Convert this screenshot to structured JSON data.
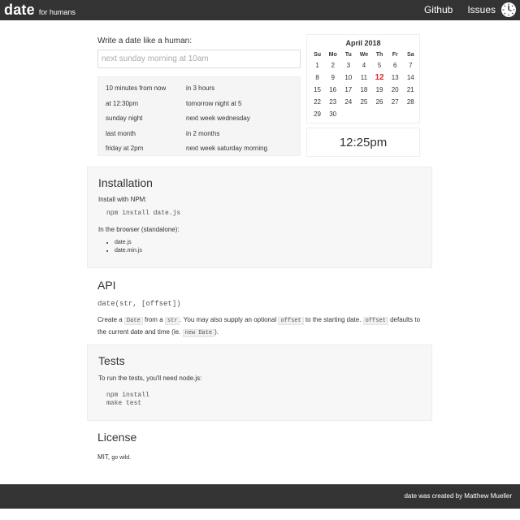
{
  "header": {
    "brand_title": "date",
    "brand_subtitle": "for humans",
    "nav": {
      "github": "Github",
      "issues": "Issues"
    },
    "logo_icon": "clock-icon"
  },
  "intro": {
    "prompt_label": "Write a date like a human:",
    "input_placeholder": "next sunday morning at 10am",
    "input_value": "",
    "examples": [
      "10 minutes from now",
      "in 3 hours",
      "at 12:30pm",
      "tomorrow night at 5",
      "sunday night",
      "next week wednesday",
      "last month",
      "in 2 months",
      "friday at 2pm",
      "next week saturday morning"
    ]
  },
  "calendar": {
    "title": "April 2018",
    "weekdays": [
      "Su",
      "Mo",
      "Tu",
      "We",
      "Th",
      "Fr",
      "Sa"
    ],
    "days": [
      "1",
      "2",
      "3",
      "4",
      "5",
      "6",
      "7",
      "8",
      "9",
      "10",
      "11",
      "12",
      "13",
      "14",
      "15",
      "16",
      "17",
      "18",
      "19",
      "20",
      "21",
      "22",
      "23",
      "24",
      "25",
      "26",
      "27",
      "28",
      "29",
      "30"
    ],
    "today": "12",
    "today_color": "#e4242d"
  },
  "time": "12:25pm",
  "installation": {
    "title": "Installation",
    "npm_label": "Install with NPM:",
    "npm_command": "npm install date.js",
    "browser_label": "In the browser (standalone):",
    "files": [
      "date.js",
      "date.min.js"
    ]
  },
  "api": {
    "title": "API",
    "signature": "date(str, [offset])",
    "desc_1": "Create a",
    "code_1": "Date",
    "desc_2": "from a",
    "code_2": "str",
    "desc_3": ". You may also supply an optional",
    "code_3": "offset",
    "desc_4": "to the starting date.",
    "code_4": "offset",
    "desc_5": "defaults to the current date and time (ie.",
    "code_5": "new Date",
    "desc_6": ")."
  },
  "tests": {
    "title": "Tests",
    "desc": "To run the tests, you'll need node.js:",
    "command_1": "npm install",
    "command_2": "make test"
  },
  "license": {
    "title": "License",
    "text_1": "MIT,",
    "text_2": "go wild."
  },
  "footer": {
    "text": "date was created by Matthew Mueller"
  },
  "colors": {
    "topbar": "#333333",
    "panel": "#f7f7f7",
    "accent": "#e4242d"
  }
}
